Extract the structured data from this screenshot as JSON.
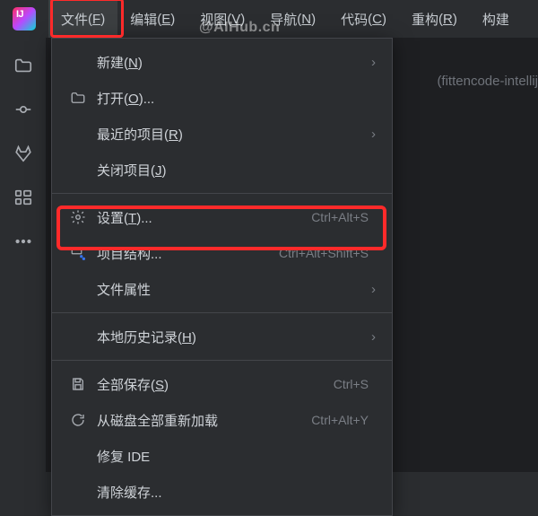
{
  "logo": "IJ",
  "watermark": "@AIHub.cn",
  "menubar": [
    {
      "label": "文件",
      "mn": "F"
    },
    {
      "label": "编辑",
      "mn": "E"
    },
    {
      "label": "视图",
      "mn": "V"
    },
    {
      "label": "导航",
      "mn": "N"
    },
    {
      "label": "代码",
      "mn": "C"
    },
    {
      "label": "重构",
      "mn": "R"
    },
    {
      "label_only": "构建"
    }
  ],
  "content_hint": "(fittencode-intellij",
  "dropdown": {
    "new": {
      "label": "新建",
      "mn": "N"
    },
    "open": {
      "label": "打开",
      "mn": "O",
      "suffix": "..."
    },
    "recent": {
      "label": "最近的项目",
      "mn": "R"
    },
    "close": {
      "label": "关闭项目",
      "mn": "J"
    },
    "settings": {
      "label": "设置",
      "mn": "T",
      "suffix": "...",
      "shortcut": "Ctrl+Alt+S"
    },
    "structure": {
      "label": "项目结构...",
      "shortcut": "Ctrl+Alt+Shift+S"
    },
    "props": {
      "label": "文件属性"
    },
    "localhist": {
      "label": "本地历史记录",
      "mn": "H"
    },
    "saveall": {
      "label": "全部保存",
      "mn": "S",
      "shortcut": "Ctrl+S"
    },
    "reload": {
      "label": "从磁盘全部重新加载",
      "shortcut": "Ctrl+Alt+Y"
    },
    "repair": {
      "label": "修复 IDE"
    },
    "invalidate": {
      "label": "清除缓存..."
    }
  }
}
